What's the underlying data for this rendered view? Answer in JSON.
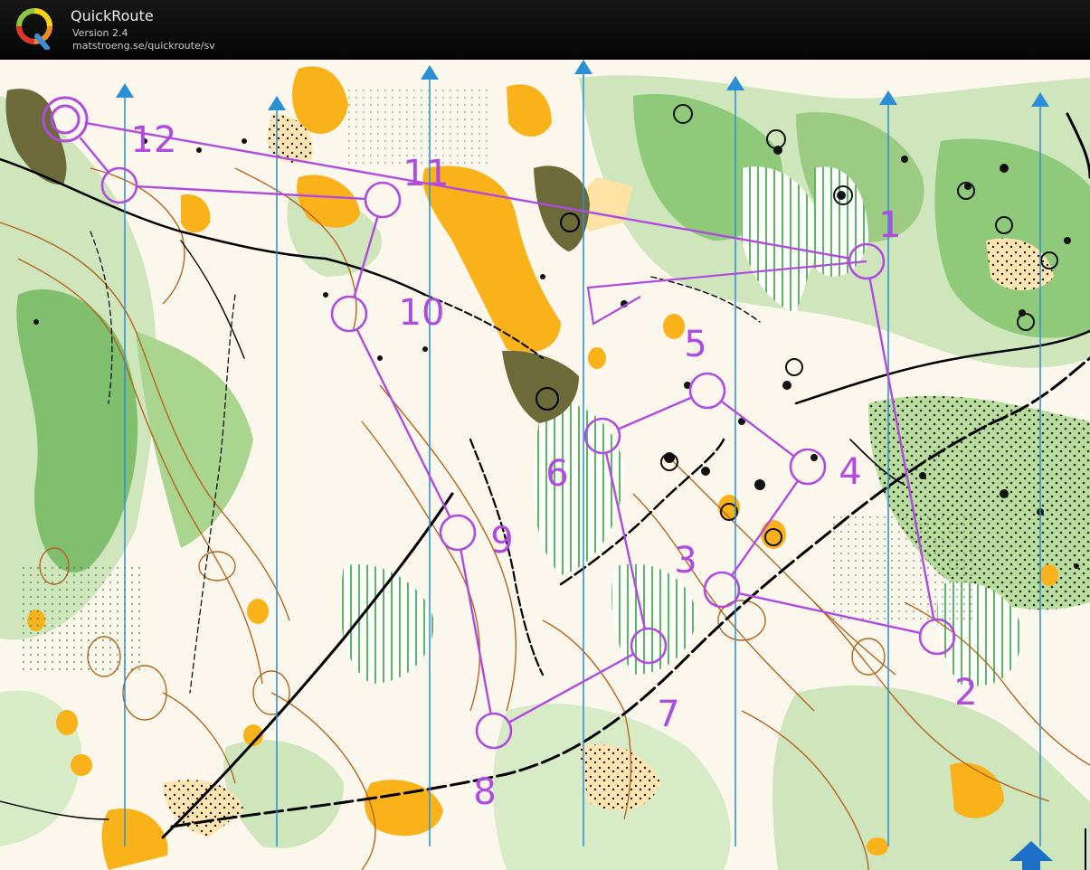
{
  "app": {
    "name": "QuickRoute",
    "version": "Version 2.4",
    "url": "matstroeng.se/quickroute/sv",
    "logo_letter": "Q"
  },
  "colors": {
    "course": "#b04be0",
    "north_lines": "#2a8fd6",
    "vegetation_light": "#c9e3b4",
    "vegetation_mid": "#9ccc84",
    "vegetation_dark": "#4f9e46",
    "open_land": "#f9b21a",
    "rough_open": "#fde2a6",
    "contours": "#b5651d",
    "paths": "#000000",
    "marsh": "#6d6a3a"
  },
  "course": {
    "controls": [
      {
        "id": "start",
        "label": ""
      },
      {
        "id": "1",
        "label": "1"
      },
      {
        "id": "2",
        "label": "2"
      },
      {
        "id": "3",
        "label": "3"
      },
      {
        "id": "4",
        "label": "4"
      },
      {
        "id": "5",
        "label": "5"
      },
      {
        "id": "6",
        "label": "6"
      },
      {
        "id": "7",
        "label": "7"
      },
      {
        "id": "8",
        "label": "8"
      },
      {
        "id": "9",
        "label": "9"
      },
      {
        "id": "10",
        "label": "10"
      },
      {
        "id": "11",
        "label": "11"
      },
      {
        "id": "12",
        "label": "12"
      },
      {
        "id": "finish",
        "label": ""
      }
    ]
  }
}
